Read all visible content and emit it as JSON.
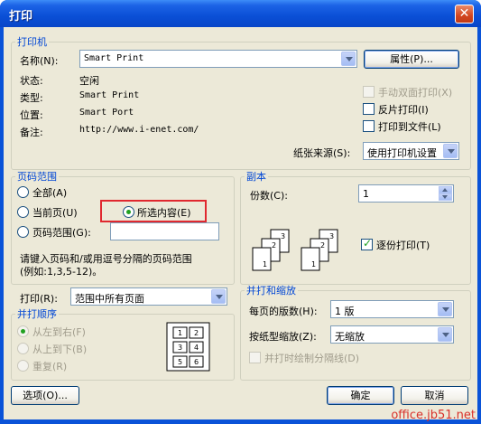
{
  "window": {
    "title": "打印"
  },
  "printer": {
    "legend": "打印机",
    "name_label": "名称(N):",
    "name_value": "Smart Print",
    "properties_button": "属性(P)...",
    "status_label": "状态:",
    "status_value": "空闲",
    "type_label": "类型:",
    "type_value": "Smart Print",
    "location_label": "位置:",
    "location_value": "Smart Port",
    "comment_label": "备注:",
    "comment_value": "http://www.i-enet.com/",
    "manual_duplex": "手动双面打印(X)",
    "reverse_print": "反片打印(I)",
    "print_to_file": "打印到文件(L)",
    "paper_source_label": "纸张来源(S):",
    "paper_source_value": "使用打印机设置"
  },
  "page_range": {
    "legend": "页码范围",
    "all": "全部(A)",
    "current_page": "当前页(U)",
    "selection": "所选内容(E)",
    "pages": "页码范围(G):",
    "pages_value": "",
    "hint_line1": "请键入页码和/或用逗号分隔的页码范围",
    "hint_line2": "(例如:1,3,5-12)。"
  },
  "copies": {
    "legend": "副本",
    "count_label": "份数(C):",
    "count_value": "1",
    "collate": "逐份打印(T)",
    "stack_pages": [
      "1",
      "2",
      "3"
    ]
  },
  "print_what": {
    "label": "打印(R):",
    "value": "范围中所有页面"
  },
  "order": {
    "legend": "并打顺序",
    "left_to_right": "从左到右(F)",
    "top_to_bottom": "从上到下(B)",
    "repeat": "重复(R)",
    "grid": [
      "1",
      "2",
      "3",
      "4",
      "5",
      "6"
    ]
  },
  "zoom": {
    "legend": "并打和缩放",
    "pages_per_sheet_label": "每页的版数(H):",
    "pages_per_sheet_value": "1 版",
    "scale_label": "按纸型缩放(Z):",
    "scale_value": "无缩放",
    "draw_borders": "并打时绘制分隔线(D)"
  },
  "footer": {
    "options_button": "选项(O)...",
    "ok_button": "确定",
    "cancel_button": "取消"
  },
  "watermark": "office.jb51.net"
}
